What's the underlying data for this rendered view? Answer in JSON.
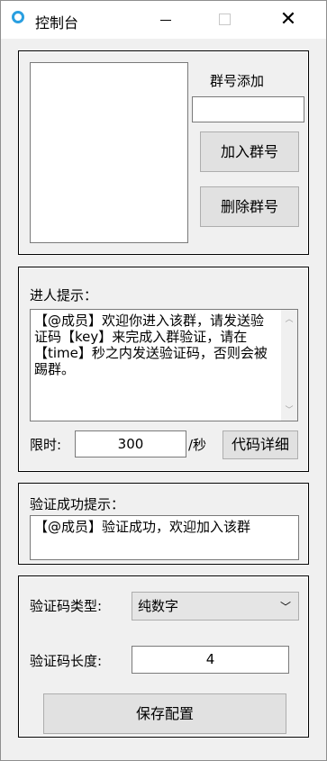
{
  "window": {
    "title": "控制台"
  },
  "group_numbers": {
    "label": "群号添加",
    "input_value": "",
    "add_button": "加入群号",
    "delete_button": "删除群号"
  },
  "join_prompt": {
    "label": "进人提示：",
    "message": "【@成员】欢迎你进入该群，请发送验证码【key】来完成入群验证，请在【time】秒之内发送验证码，否则会被踢群。",
    "limit_label": "限时:",
    "limit_value": "300",
    "limit_unit": "/秒",
    "code_detail_button": "代码详细"
  },
  "verify_success": {
    "label": "验证成功提示：",
    "message": "【@成员】验证成功，欢迎加入该群"
  },
  "captcha": {
    "type_label": "验证码类型:",
    "type_value": "纯数字",
    "length_label": "验证码长度:",
    "length_value": "4",
    "save_button": "保存配置"
  }
}
